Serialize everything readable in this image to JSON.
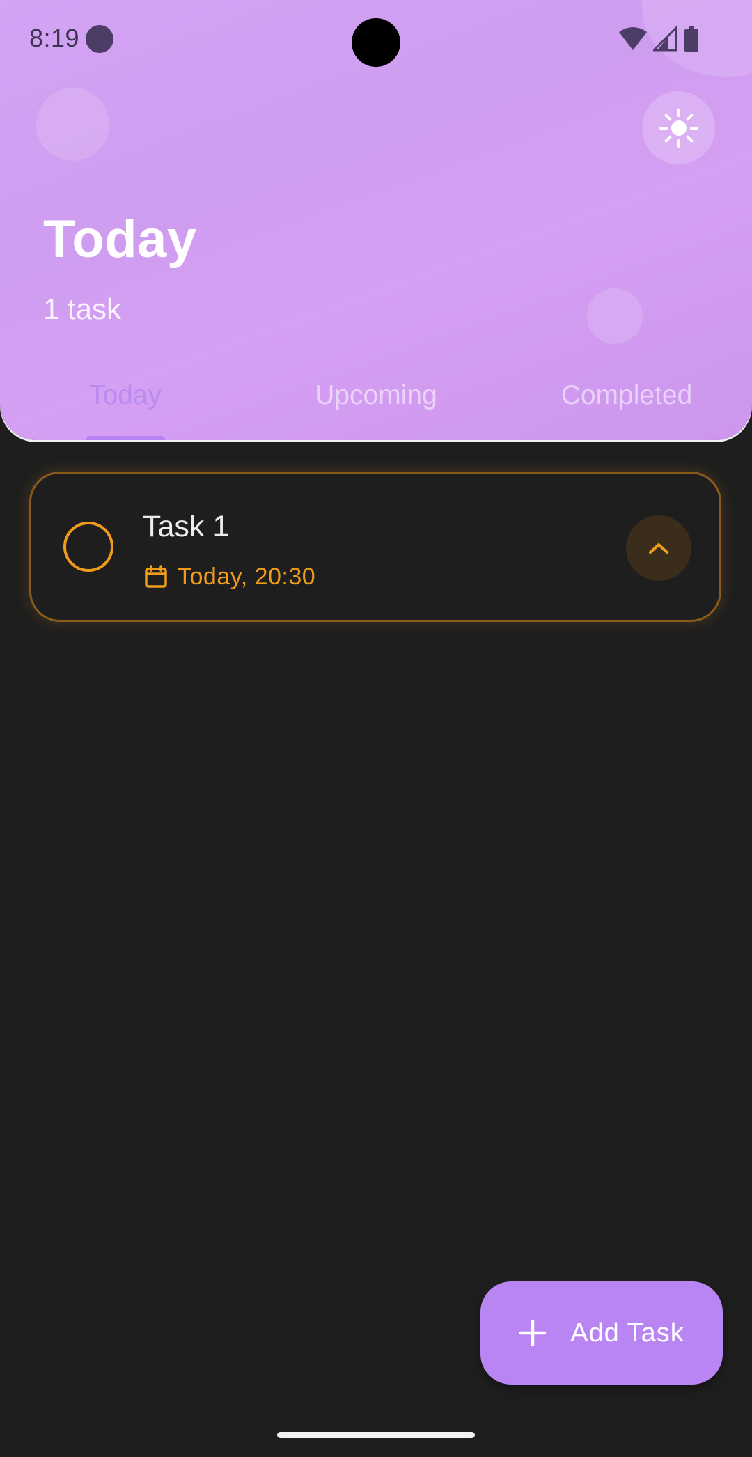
{
  "status_bar": {
    "time": "8:19",
    "icons": [
      "notification-dot-icon",
      "wifi-icon",
      "cellular-signal-icon",
      "battery-icon"
    ]
  },
  "header": {
    "title": "Today",
    "subtitle": "1 task",
    "theme_toggle_icon": "sun-icon"
  },
  "tabs": [
    {
      "label": "Today",
      "active": true
    },
    {
      "label": "Upcoming",
      "active": false
    },
    {
      "label": "Completed",
      "active": false
    }
  ],
  "tasks": [
    {
      "title": "Task 1",
      "due": "Today, 20:30",
      "due_icon": "calendar-icon",
      "completed": false,
      "expand_icon": "chevron-up-icon"
    }
  ],
  "fab": {
    "label": "Add Task",
    "icon": "plus-icon"
  },
  "colors": {
    "header_gradient": "#d3a3f4",
    "accent_purple": "#b985f3",
    "task_accent_orange": "#f09c1a",
    "background": "#1e1e1e"
  }
}
